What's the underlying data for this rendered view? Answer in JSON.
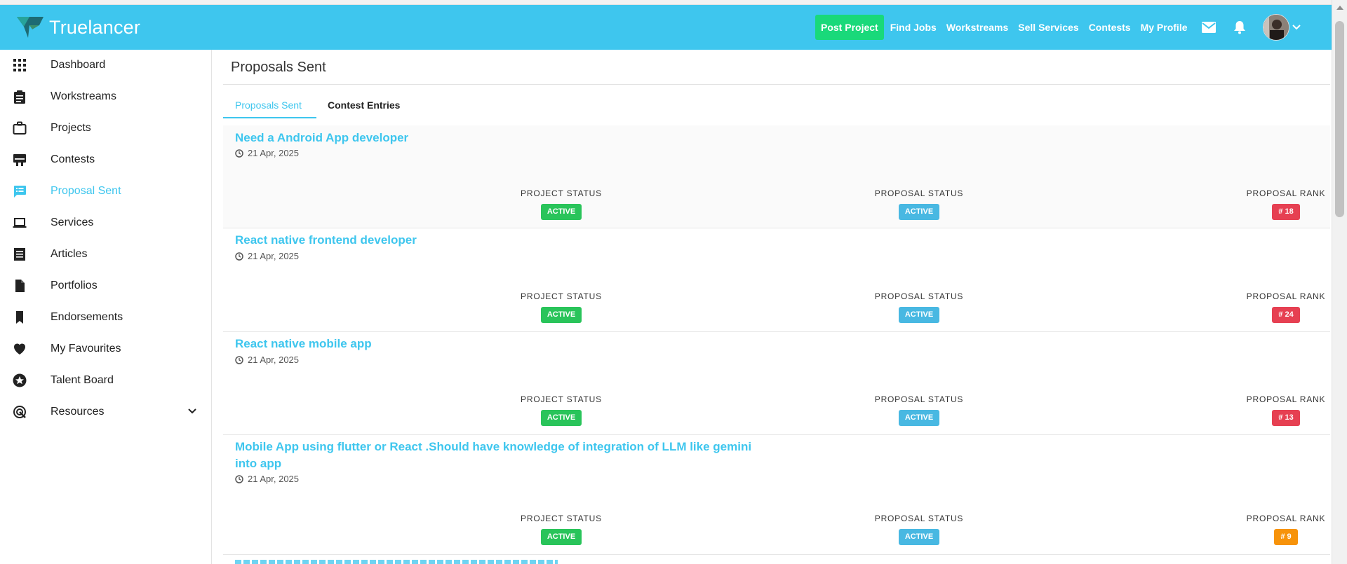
{
  "header": {
    "logo_text": "Truelancer",
    "post_project": "Post Project",
    "nav_links": [
      "Find Jobs",
      "Workstreams",
      "Sell Services",
      "Contests",
      "My Profile"
    ],
    "brand_color": "#3ec6ee",
    "accent_color": "#19d97a"
  },
  "sidebar": {
    "items": [
      {
        "label": "Dashboard",
        "icon": "grid-icon"
      },
      {
        "label": "Workstreams",
        "icon": "clipboard-icon"
      },
      {
        "label": "Projects",
        "icon": "briefcase-icon"
      },
      {
        "label": "Contests",
        "icon": "contest-icon"
      },
      {
        "label": "Proposal Sent",
        "icon": "proposal-icon",
        "active": true
      },
      {
        "label": "Services",
        "icon": "laptop-icon"
      },
      {
        "label": "Articles",
        "icon": "article-icon"
      },
      {
        "label": "Portfolios",
        "icon": "file-icon"
      },
      {
        "label": "Endorsements",
        "icon": "bookmark-icon"
      },
      {
        "label": "My Favourites",
        "icon": "heart-icon"
      },
      {
        "label": "Talent Board",
        "icon": "star-icon"
      },
      {
        "label": "Resources",
        "icon": "resources-icon"
      }
    ]
  },
  "main": {
    "page_title": "Proposals Sent",
    "tabs": [
      {
        "label": "Proposals Sent",
        "active": true
      },
      {
        "label": "Contest Entries",
        "active": false
      }
    ],
    "labels": {
      "project_status": "PROJECT STATUS",
      "proposal_status": "PROPOSAL STATUS",
      "proposal_rank": "PROPOSAL RANK"
    },
    "proposals": [
      {
        "title": "Need a Android App developer",
        "date": "21 Apr, 2025",
        "project_status": "ACTIVE",
        "proposal_status": "ACTIVE",
        "rank": "# 18",
        "rank_color": "#e64052"
      },
      {
        "title": "React native frontend developer",
        "date": "21 Apr, 2025",
        "project_status": "ACTIVE",
        "proposal_status": "ACTIVE",
        "rank": "# 24",
        "rank_color": "#e64052"
      },
      {
        "title": "React native mobile app",
        "date": "21 Apr, 2025",
        "project_status": "ACTIVE",
        "proposal_status": "ACTIVE",
        "rank": "# 13",
        "rank_color": "#e64052"
      },
      {
        "title": "Mobile App using flutter or React .Should have knowledge of integration of LLM like gemini into app",
        "date": "21 Apr, 2025",
        "project_status": "ACTIVE",
        "proposal_status": "ACTIVE",
        "rank": "# 9",
        "rank_color": "#f7930a"
      }
    ]
  }
}
